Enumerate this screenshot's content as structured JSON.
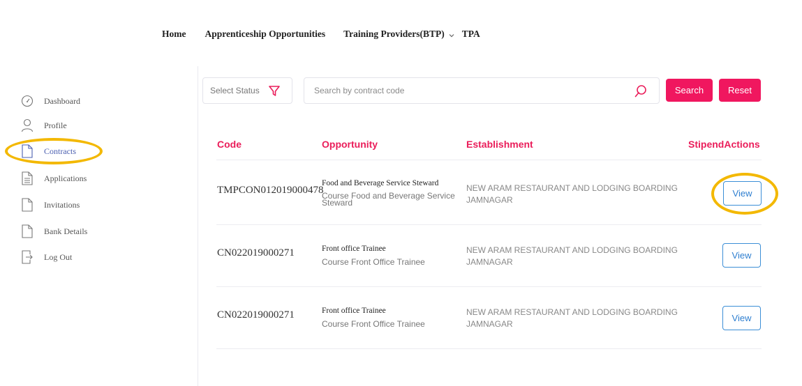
{
  "nav": {
    "home": "Home",
    "apprenticeship": "Apprenticeship Opportunities",
    "training_providers": "Training Providers(BTP)",
    "tpa": "TPA"
  },
  "sidebar": {
    "items": [
      {
        "label": "Dashboard",
        "icon": "dashboard-icon"
      },
      {
        "label": "Profile",
        "icon": "user-icon"
      },
      {
        "label": "Contracts",
        "icon": "document-icon",
        "active": true
      },
      {
        "label": "Applications",
        "icon": "document-lines-icon"
      },
      {
        "label": "Invitations",
        "icon": "document-icon"
      },
      {
        "label": "Bank Details",
        "icon": "document-icon"
      },
      {
        "label": "Log Out",
        "icon": "logout-icon"
      }
    ]
  },
  "filters": {
    "status_placeholder": "Select Status",
    "search_placeholder": "Search by contract code",
    "search_button": "Search",
    "reset_button": "Reset"
  },
  "table": {
    "headers": {
      "code": "Code",
      "opportunity": "Opportunity",
      "establishment": "Establishment",
      "stipend_actions": "StipendActions"
    },
    "rows": [
      {
        "code": "TMPCON012019000478",
        "opportunity": "Food and Beverage Service Steward",
        "course_line1": "Course Food and Beverage Service",
        "course_line2": "Steward",
        "establishment_line1": "NEW ARAM RESTAURANT AND LODGING BOARDING",
        "establishment_line2": "JAMNAGAR",
        "action": "View"
      },
      {
        "code": "CN022019000271",
        "opportunity": "Front office Trainee",
        "course_line1": "Course Front Office Trainee",
        "course_line2": "",
        "establishment_line1": "NEW ARAM RESTAURANT AND LODGING BOARDING",
        "establishment_line2": "JAMNAGAR",
        "action": "View"
      },
      {
        "code": "CN022019000271",
        "opportunity": "Front office Trainee",
        "course_line1": "Course Front Office Trainee",
        "course_line2": "",
        "establishment_line1": "NEW ARAM RESTAURANT AND LODGING BOARDING",
        "establishment_line2": "JAMNAGAR",
        "action": "View"
      }
    ]
  },
  "colors": {
    "accent_pink": "#f0175f",
    "header_pink": "#ea1d5a",
    "view_blue": "#2f7fd0",
    "highlight_yellow": "#f3b800",
    "active_sidebar": "#4b5fb0"
  }
}
